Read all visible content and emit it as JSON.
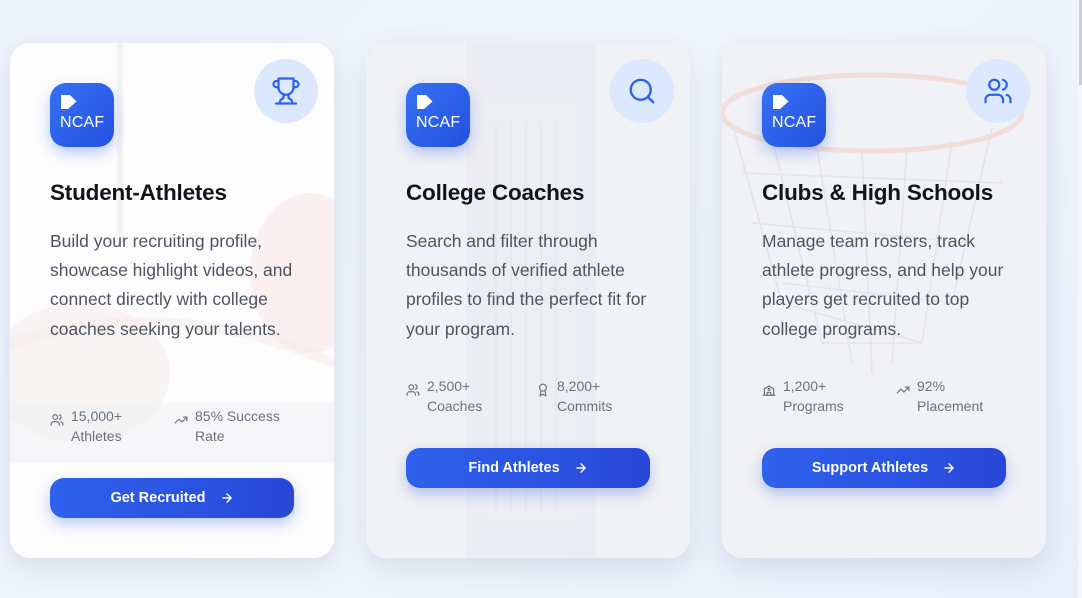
{
  "cards": [
    {
      "logo_text": "NCAF",
      "corner_icon": "trophy-icon",
      "title": "Student-Athletes",
      "description": "Build your recruiting profile, showcase highlight videos, and connect directly with college coaches seeking your talents.",
      "stats": [
        {
          "icon": "users-icon",
          "line1": "15,000+",
          "line2": "Athletes"
        },
        {
          "icon": "trending-up-icon",
          "line1": "85% Success",
          "line2": "Rate"
        }
      ],
      "cta_label": "Get Recruited"
    },
    {
      "logo_text": "NCAF",
      "corner_icon": "search-icon",
      "title": "College Coaches",
      "description": "Search and filter through thousands of verified athlete profiles to find the perfect fit for your program.",
      "stats": [
        {
          "icon": "users-icon",
          "line1": "2,500+",
          "line2": "Coaches"
        },
        {
          "icon": "award-icon",
          "line1": "8,200+",
          "line2": "Commits"
        }
      ],
      "cta_label": "Find Athletes"
    },
    {
      "logo_text": "NCAF",
      "corner_icon": "users-icon",
      "title": "Clubs & High Schools",
      "description": "Manage team rosters, track athlete progress, and help your players get recruited to top college programs.",
      "stats": [
        {
          "icon": "school-icon",
          "line1": "1,200+",
          "line2": "Programs"
        },
        {
          "icon": "trending-up-icon",
          "line1": "92%",
          "line2": "Placement"
        }
      ],
      "cta_label": "Support Athletes"
    }
  ],
  "colors": {
    "accent": "#2f62ec",
    "accent_dark": "#2847d8",
    "icon_circle": "#dce8fe",
    "title": "#12141b",
    "body_text": "#4d5563",
    "muted_text": "#6b7280"
  }
}
